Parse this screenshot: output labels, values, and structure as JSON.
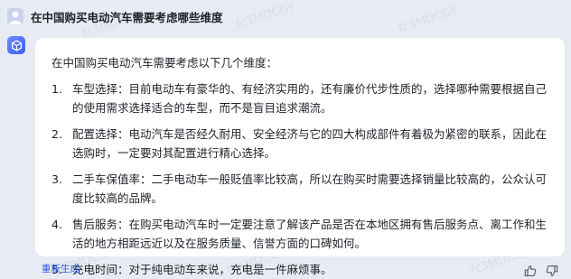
{
  "question": "在中国购买电动汽车需要考虑哪些维度",
  "answer": {
    "intro": "在中国购买电动汽车需要考虑以下几个维度：",
    "points": [
      {
        "num": "1.",
        "text": "车型选择：目前电动车有豪华的、有经济实用的，还有廉价代步性质的，选择哪种需要根据自己的使用需求选择适合的车型，而不是盲目追求潮流。"
      },
      {
        "num": "2.",
        "text": "配置选择：电动汽车是否经久耐用、安全经济与它的四大构成部件有着极为紧密的联系，因此在选购时，一定要对其配置进行精心选择。"
      },
      {
        "num": "3.",
        "text": "二手车保值率：二手电动车一般贬值率比较高，所以在购买时需要选择销量比较高的，公众认可度比较高的品牌。"
      },
      {
        "num": "4.",
        "text": "售后服务：在购买电动汽车时一定要注意了解该产品是否在本地区拥有售后服务点、离工作和生活的地方相距远近以及在服务质量、信誉方面的口碑如何。"
      },
      {
        "num": "5.",
        "text": "充电时间：对于纯电动车来说，充电是一件麻烦事。"
      }
    ]
  },
  "footer": {
    "regenerate_label": "重新生成"
  },
  "icons": {
    "user_avatar": "user-avatar-icon",
    "bot_avatar": "bot-cube-icon",
    "like": "thumbs-up-icon",
    "dislike": "thumbs-down-icon"
  },
  "watermark": "fc3MDCGY",
  "colors": {
    "background": "#e8ebf3",
    "card": "#ffffff",
    "accent": "#2f5bea",
    "bot_avatar": "#4a6cf7"
  }
}
